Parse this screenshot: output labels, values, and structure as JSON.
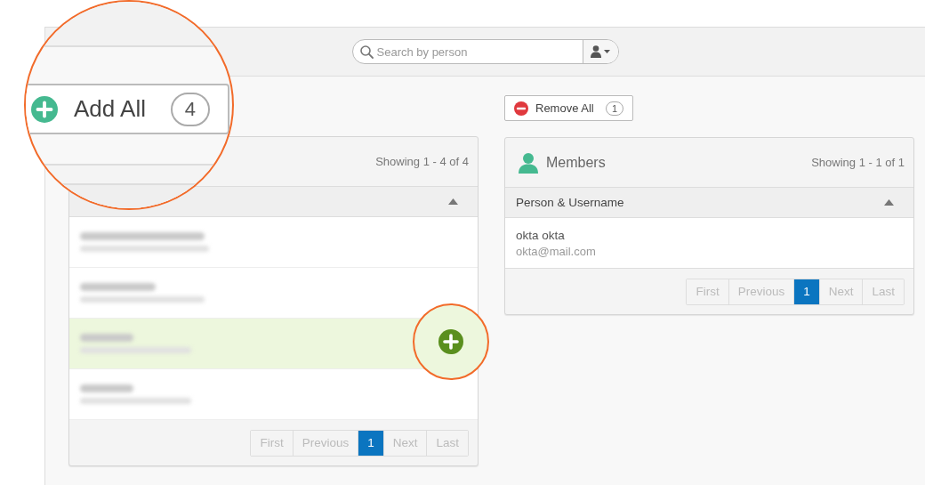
{
  "search": {
    "placeholder": "Search by person"
  },
  "callout": {
    "label": "Add All",
    "count": "4"
  },
  "remove_all": {
    "label": "Remove All",
    "count": "1"
  },
  "nonmembers": {
    "showing": "Showing 1 - 4 of 4",
    "rows": [
      {
        "selected": false
      },
      {
        "selected": false
      },
      {
        "selected": true
      },
      {
        "selected": false
      }
    ],
    "pagination": [
      {
        "label": "First",
        "selected": false,
        "disabled": true
      },
      {
        "label": "Previous",
        "selected": false,
        "disabled": true
      },
      {
        "label": "1",
        "selected": true,
        "disabled": false
      },
      {
        "label": "Next",
        "selected": false,
        "disabled": true
      },
      {
        "label": "Last",
        "selected": false,
        "disabled": true
      }
    ]
  },
  "members": {
    "title": "Members",
    "showing": "Showing 1 - 1 of 1",
    "column": "Person & Username",
    "rows": [
      {
        "name": "okta okta",
        "email": "okta@mail.com"
      }
    ],
    "pagination": [
      {
        "label": "First",
        "selected": false,
        "disabled": true
      },
      {
        "label": "Previous",
        "selected": false,
        "disabled": true
      },
      {
        "label": "1",
        "selected": true,
        "disabled": false
      },
      {
        "label": "Next",
        "selected": false,
        "disabled": true
      },
      {
        "label": "Last",
        "selected": false,
        "disabled": true
      }
    ]
  }
}
